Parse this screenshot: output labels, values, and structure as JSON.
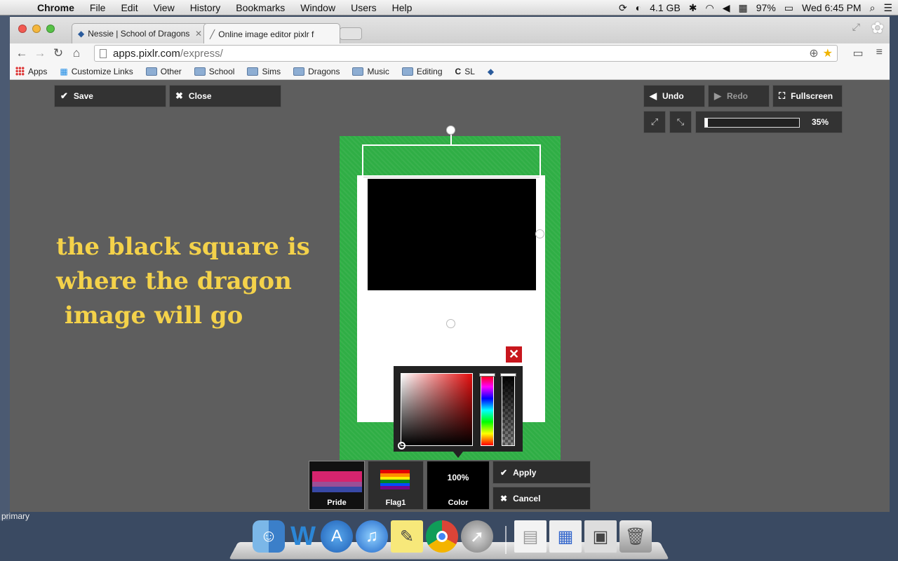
{
  "menubar": {
    "app": "Chrome",
    "items": [
      "File",
      "Edit",
      "View",
      "History",
      "Bookmarks",
      "Window",
      "Users",
      "Help"
    ],
    "memory": "4.1 GB",
    "battery": "97%",
    "clock": "Wed 6:45 PM"
  },
  "desktop": {
    "labels": [
      "primary"
    ]
  },
  "browser": {
    "tabs": [
      {
        "title": "Nessie | School of Dragons",
        "active": false
      },
      {
        "title": "Online image editor pixlr f",
        "active": true
      }
    ],
    "url_host": "apps.pixlr.com",
    "url_path": "/express/",
    "bookmarks": [
      "Apps",
      "Customize Links",
      "Other",
      "School",
      "Sims",
      "Dragons",
      "Music",
      "Editing",
      "SL"
    ]
  },
  "editor": {
    "save_label": "Save",
    "close_label": "Close",
    "undo_label": "Undo",
    "redo_label": "Redo",
    "fullscreen_label": "Fullscreen",
    "zoom_value": 35,
    "zoom_text": "35%",
    "annotation_line1": "the black square is",
    "annotation_line2": "where the dragon",
    "annotation_line3": " image will go",
    "swatches": [
      {
        "label": "Pride"
      },
      {
        "label": "Flag1"
      },
      {
        "label": "Color",
        "value": "100%"
      }
    ],
    "apply_label": "Apply",
    "cancel_label": "Cancel",
    "colors": {
      "canvas_green": "#2fae45",
      "annotation": "#f4d24a",
      "close_red": "#c8161d",
      "picker_hue": "#e40d0d"
    }
  }
}
